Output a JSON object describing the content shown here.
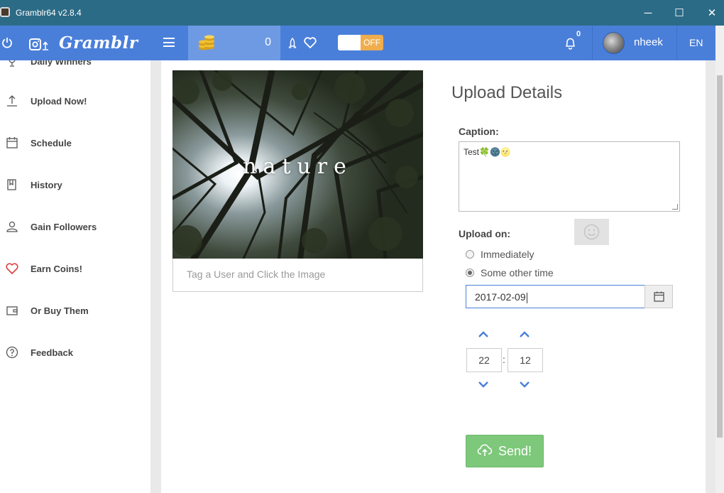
{
  "window": {
    "title": "Gramblr64 v2.8.4",
    "minimize_glyph": "─",
    "maximize_glyph": "☐",
    "close_glyph": "✕"
  },
  "header": {
    "brand": "Gramblr",
    "coins": "0",
    "toggle_state": "OFF",
    "notification_count": "0",
    "username": "nheek",
    "language": "EN",
    "accent_color": "#4a7fd9",
    "icons": [
      "power-icon",
      "camera-upload-icon",
      "menu-icon",
      "coins-icon",
      "rocket-icon",
      "heart-icon",
      "bell-icon"
    ]
  },
  "sidebar": {
    "items": [
      {
        "label": "Daily Winners",
        "icon": "trophy-icon"
      },
      {
        "label": "Upload Now!",
        "icon": "upload-icon"
      },
      {
        "label": "Schedule",
        "icon": "calendar-icon"
      },
      {
        "label": "History",
        "icon": "bookmark-icon"
      },
      {
        "label": "Gain Followers",
        "icon": "user-icon"
      },
      {
        "label": "Earn Coins!",
        "icon": "heart-icon"
      },
      {
        "label": "Or Buy Them",
        "icon": "wallet-icon"
      },
      {
        "label": "Feedback",
        "icon": "question-icon"
      }
    ]
  },
  "upload": {
    "image_text": "nature",
    "tag_placeholder": "Tag a User and Click the Image",
    "details_title": "Upload Details",
    "caption_label": "Caption:",
    "caption_value": "Test🍀🌚🌝",
    "upload_on_label": "Upload on:",
    "options": [
      {
        "label": "Immediately",
        "selected": false
      },
      {
        "label": "Some other time",
        "selected": true
      }
    ],
    "date_value": "2017-02-09",
    "hour": "22",
    "minute": "12",
    "time_separator": ":",
    "send_label": "Send!",
    "send_color": "#7dc87a"
  }
}
